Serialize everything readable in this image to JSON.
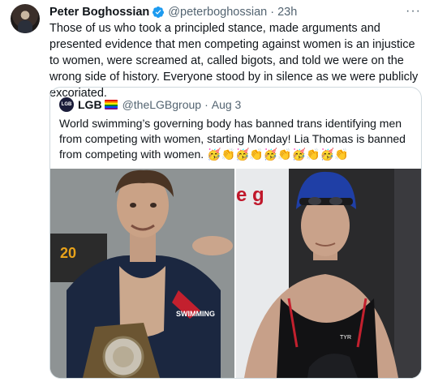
{
  "tweet": {
    "author_name": "Peter Boghossian",
    "handle": "@peterboghossian",
    "separator": "·",
    "time": "23h",
    "more_label": "···",
    "text": "Those of us who took a principled stance, made arguments and presented evidence that men competing against women is an injustice to women, were screamed at, called bigots, and told we were on the wrong side of history. Everyone stood by in silence as we were publicly excoriated."
  },
  "quoted": {
    "avatar_text": "LGB",
    "name": "LGB",
    "handle": "@theLGBgroup",
    "separator": "·",
    "time": "Aug 3",
    "text": "World swimming’s governing body has banned trans identifying men from competing with women, starting Monday! Lia Thomas is banned from competing with women.",
    "emojis": "🥳👏🥳👏🥳👏🥳👏🥳👏",
    "image_left_text": "20",
    "image_left_logo": "SWIMMING",
    "image_right_letters": "e g",
    "image_right_brand": "TYR"
  },
  "colors": {
    "accent": "#1d9bf0",
    "secondary_text": "#536471",
    "border": "#cfd9de"
  },
  "icons": {
    "verified": "verified-badge-icon",
    "more": "more-options-icon"
  }
}
